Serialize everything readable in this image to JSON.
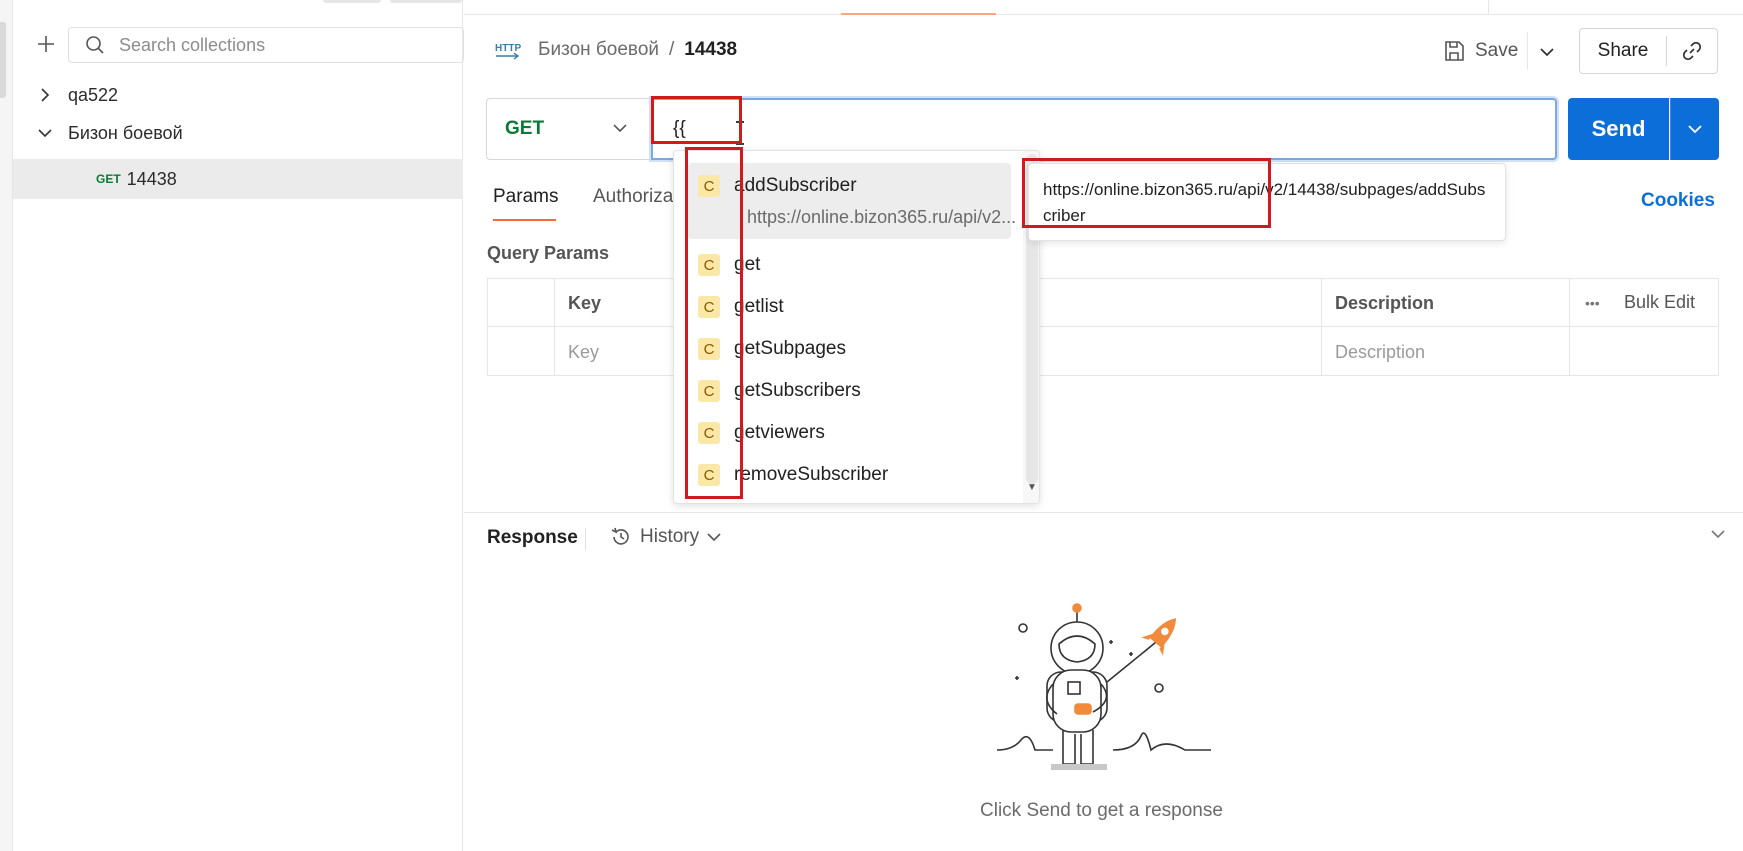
{
  "sidebar": {
    "search_placeholder": "Search collections",
    "items": [
      {
        "label": "qa522",
        "expanded": false
      },
      {
        "label": "Бизон боевой",
        "expanded": true
      },
      {
        "method": "GET",
        "label": "14438",
        "selected": true
      }
    ]
  },
  "header": {
    "collection": "Бизон боевой",
    "separator": "/",
    "request_name": "14438",
    "save_label": "Save",
    "share_label": "Share"
  },
  "request": {
    "method": "GET",
    "url_value": "{{",
    "send_label": "Send"
  },
  "tabs": {
    "params": "Params",
    "authorization": "Authoriza",
    "cookies": "Cookies"
  },
  "query_params": {
    "title": "Query Params",
    "columns": {
      "key": "Key",
      "description": "Description",
      "bulk_edit": "Bulk Edit"
    },
    "placeholders": {
      "key": "Key",
      "description": "Description"
    }
  },
  "autocomplete": {
    "badge": "C",
    "items": [
      {
        "name": "addSubscriber",
        "url": "https://online.bizon365.ru/api/v2..."
      },
      {
        "name": "get"
      },
      {
        "name": "getlist"
      },
      {
        "name": "getSubpages"
      },
      {
        "name": "getSubscribers"
      },
      {
        "name": "getviewers"
      },
      {
        "name": "removeSubscriber"
      }
    ],
    "tooltip": "https://online.bizon365.ru/api/v2/14438/subpages/addSubscriber"
  },
  "response": {
    "title": "Response",
    "history_label": "History",
    "empty_message": "Click Send to get a response"
  },
  "colors": {
    "send": "#0c6fd9",
    "method_get": "#0b7a36",
    "tab_accent": "#f26b3a",
    "annotation": "#d11a1a",
    "variable_badge": "#fbe7a6"
  }
}
